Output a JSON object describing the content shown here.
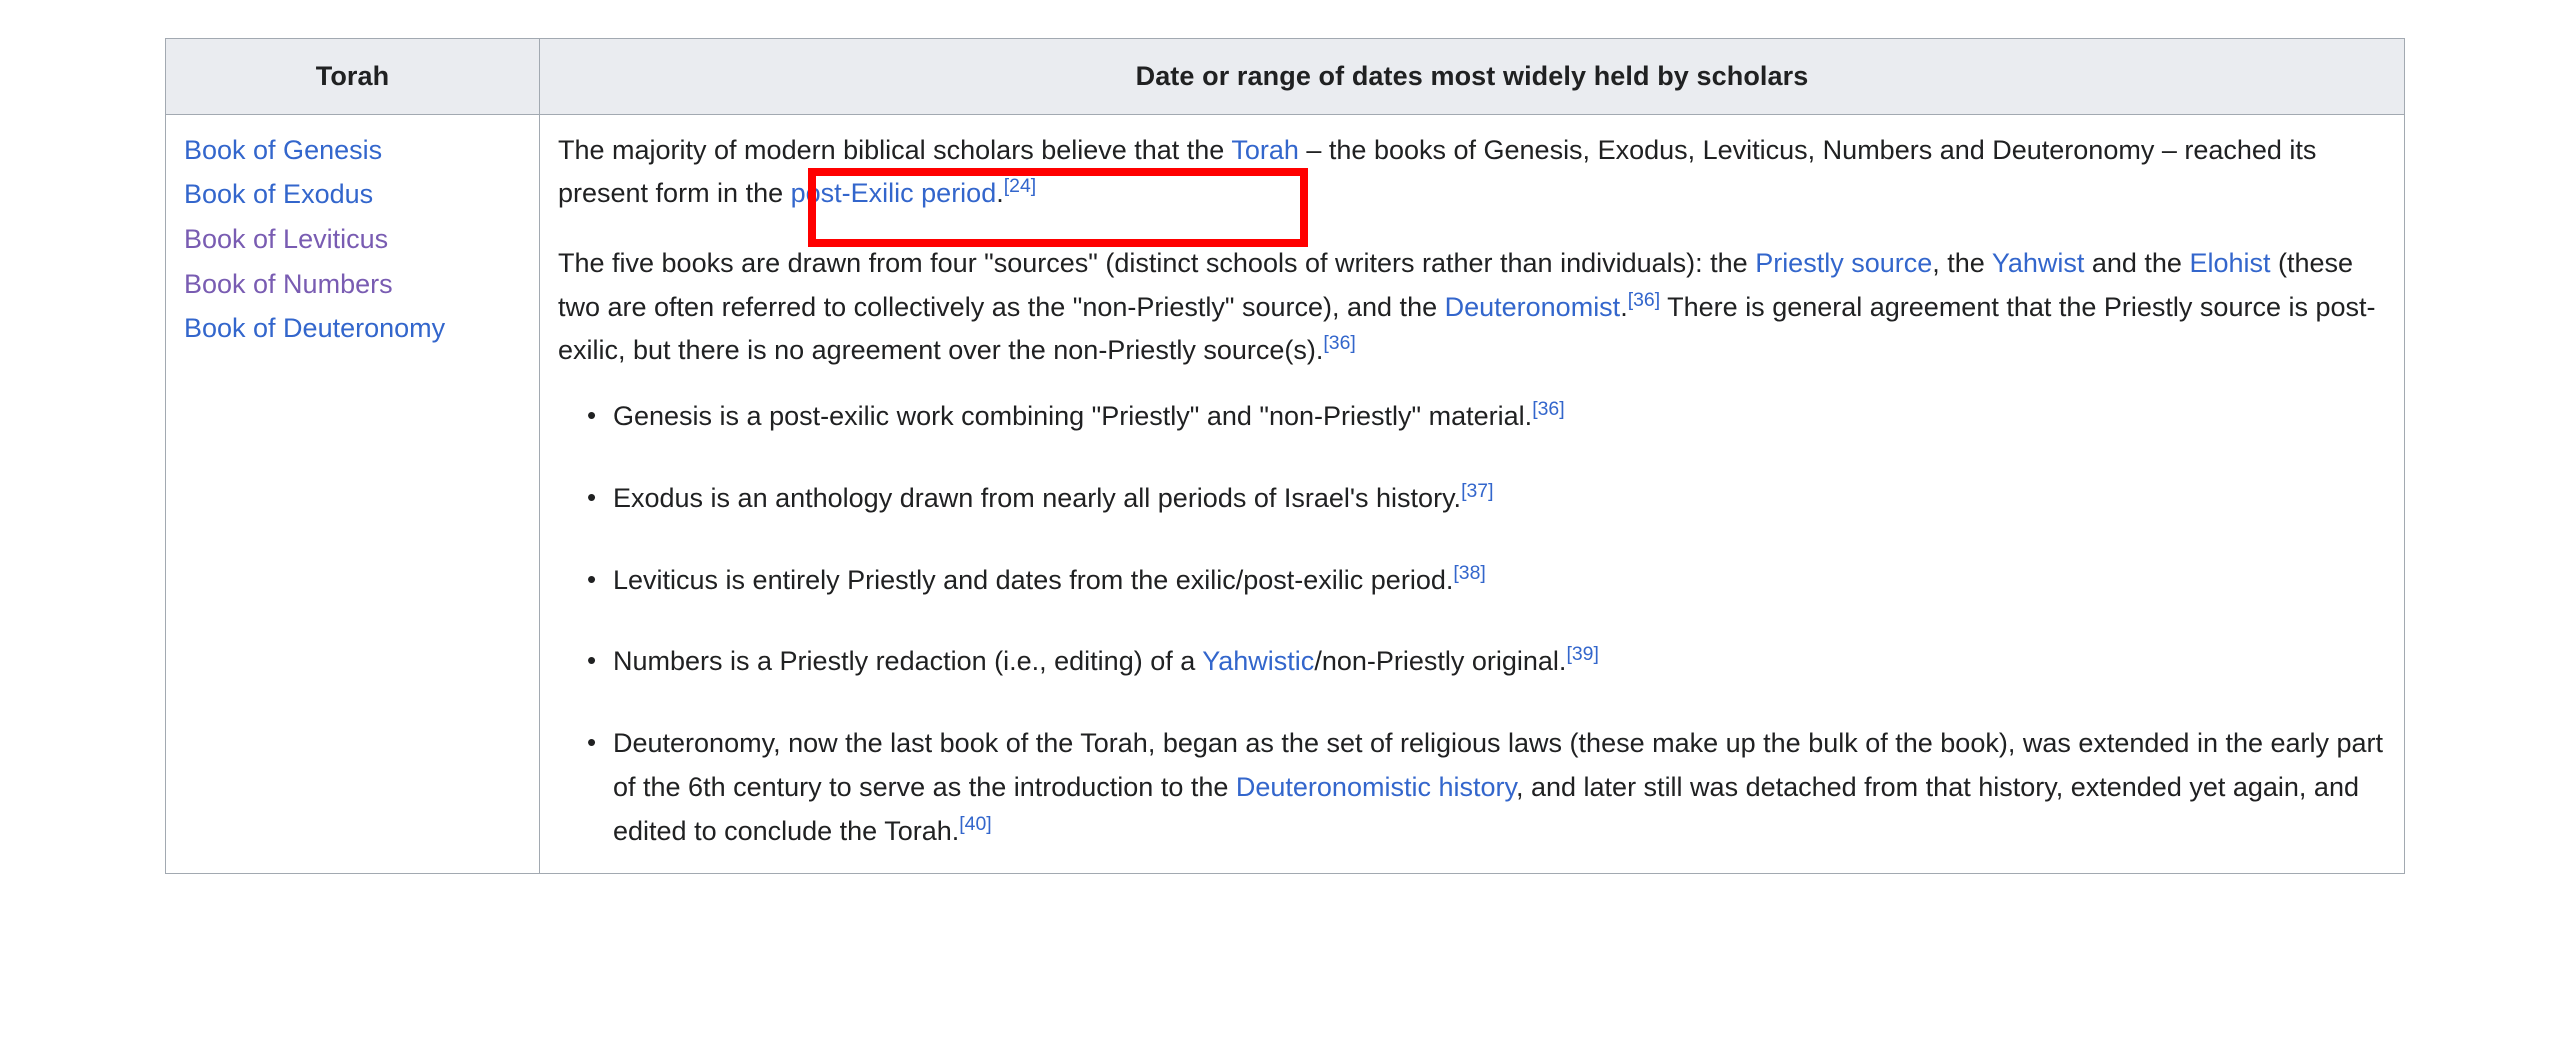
{
  "table": {
    "headers": [
      "Torah",
      "Date or range of dates most widely held by scholars"
    ],
    "book_column": {
      "links": [
        {
          "label": "Book of Genesis",
          "state": "unvisited"
        },
        {
          "label": "Book of Exodus",
          "state": "unvisited"
        },
        {
          "label": "Book of Leviticus",
          "state": "visited"
        },
        {
          "label": "Book of Numbers",
          "state": "visited"
        },
        {
          "label": "Book of Deuteronomy",
          "state": "unvisited"
        }
      ]
    },
    "content_column": {
      "paragraph1": {
        "part1": "The majority of modern biblical scholars believe that the ",
        "link1": "Torah",
        "part2": " – the books of Genesis, Exodus, Leviticus, Numbers and Deuteronomy – reached its present form in the ",
        "link2": "post-Exilic period",
        "part3": ".",
        "ref1": "[24]"
      },
      "paragraph2": {
        "part1": "The five books are drawn from four \"sources\" (distinct schools of writers rather than individuals): the ",
        "link1": "Priestly source",
        "part2": ", the ",
        "link2": "Yahwist",
        "part3": " and the ",
        "link3": "Elohist",
        "part4": " (these two are often referred to collectively as the \"non-Priestly\" source), and the ",
        "link4": "Deuteronomist",
        "part5": ".",
        "ref1": "[36]",
        "part6": " There is general agreement that the Priestly source is post-exilic, but there is no agreement over the non-Priestly source(s).",
        "ref2": "[36]"
      },
      "bullets": [
        {
          "part1": "Genesis is a post-exilic work combining \"Priestly\" and \"non-Priestly\" material.",
          "ref1": "[36]"
        },
        {
          "part1": "Exodus is an anthology drawn from nearly all periods of Israel's history.",
          "ref1": "[37]"
        },
        {
          "part1": "Leviticus is entirely Priestly and dates from the exilic/post-exilic period.",
          "ref1": "[38]"
        },
        {
          "part1": "Numbers is a Priestly redaction (i.e., editing) of a ",
          "link1": "Yahwistic",
          "part2": "/non-Priestly original.",
          "ref1": "[39]"
        },
        {
          "part1": "Deuteronomy, now the last book of the Torah, began as the set of religious laws (these make up the bulk of the book), was extended in the early part of the 6th century to serve as the introduction to the ",
          "link1": "Deuteronomistic history",
          "part2": ", and later still was detached from that history, extended yet again, and edited to conclude the Torah.",
          "ref1": "[40]"
        }
      ]
    }
  },
  "annotation": {
    "shape": "rectangle",
    "color": "#ff0000",
    "covers_text": "y – reached its present form in"
  },
  "colors": {
    "link": "#3366cc",
    "link_visited": "#795cb2",
    "table_border": "#a2a9b1",
    "header_background": "#eaecf0",
    "text": "#202122",
    "annotation": "#ff0000",
    "page_background": "#ffffff"
  }
}
